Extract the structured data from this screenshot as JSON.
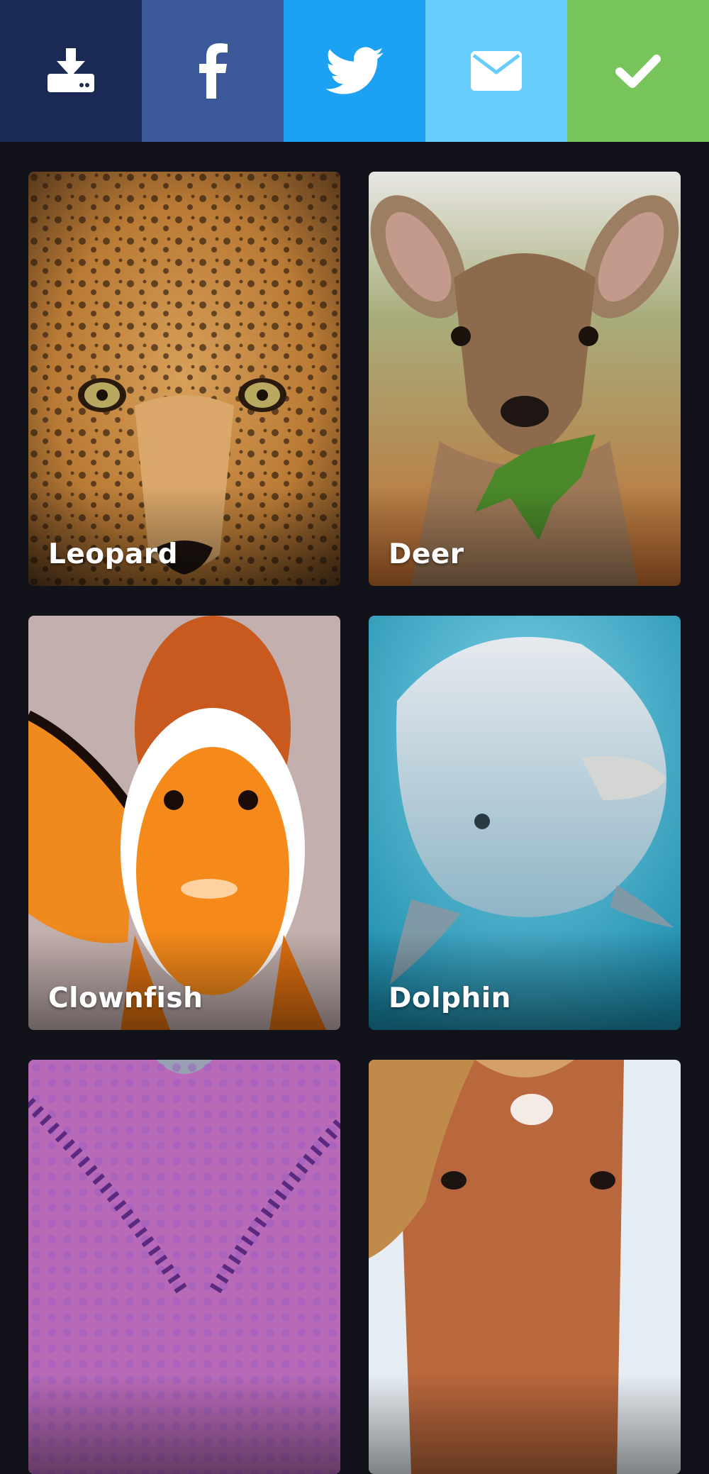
{
  "share_bar": {
    "buttons": [
      {
        "icon": "download-icon",
        "color": "#1b2a55"
      },
      {
        "icon": "facebook-icon",
        "color": "#3b5998"
      },
      {
        "icon": "twitter-icon",
        "color": "#1da1f2"
      },
      {
        "icon": "email-icon",
        "color": "#66cdfc"
      },
      {
        "icon": "check-icon",
        "color": "#76c45a"
      }
    ]
  },
  "gallery": {
    "cards": [
      {
        "label": "Leopard",
        "image": "leopard-face-photo"
      },
      {
        "label": "Deer",
        "image": "deer-fawn-photo"
      },
      {
        "label": "Clownfish",
        "image": "clownfish-photo"
      },
      {
        "label": "Dolphin",
        "image": "dolphin-photo"
      },
      {
        "label": "",
        "image": "purple-starfish-photo"
      },
      {
        "label": "",
        "image": "horse-face-photo"
      }
    ]
  }
}
